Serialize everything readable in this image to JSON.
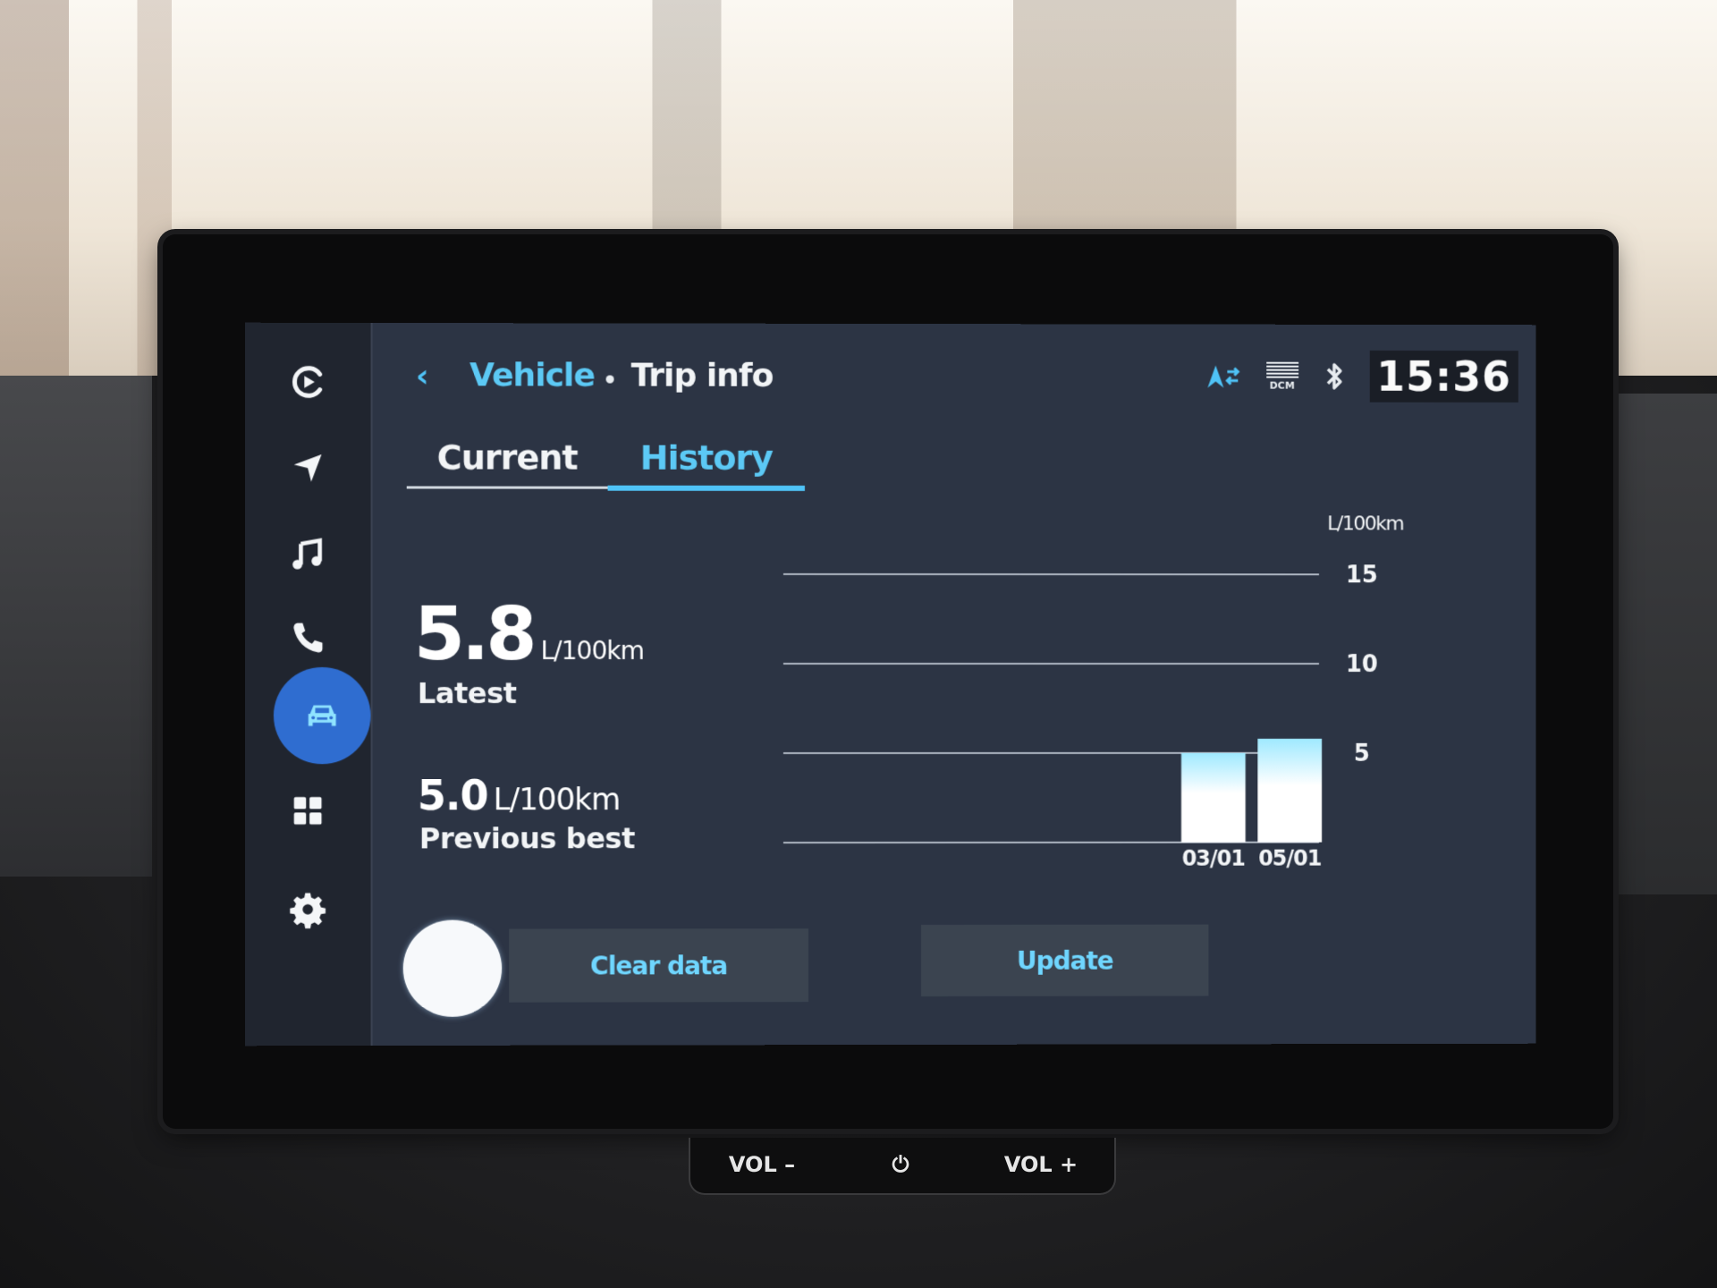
{
  "header": {
    "back_glyph": "‹",
    "breadcrumb_parent": "Vehicle",
    "page_title": "Trip info",
    "status": {
      "nav_icon": "navigation-sync-icon",
      "dcm_label": "DCM",
      "bluetooth_icon": "bluetooth-icon",
      "clock": "15:36"
    }
  },
  "sidebar": {
    "items": [
      {
        "name": "media-player",
        "icon": "play-circle-icon",
        "active": false
      },
      {
        "name": "navigation",
        "icon": "navigation-arrow-icon",
        "active": false
      },
      {
        "name": "music",
        "icon": "music-note-icon",
        "active": false
      },
      {
        "name": "phone",
        "icon": "phone-icon",
        "active": false
      },
      {
        "name": "vehicle",
        "icon": "car-icon",
        "active": true
      },
      {
        "name": "apps",
        "icon": "grid-icon",
        "active": false
      },
      {
        "name": "settings",
        "icon": "gear-icon",
        "active": false
      }
    ]
  },
  "tabs": [
    {
      "label": "Current",
      "active": false
    },
    {
      "label": "History",
      "active": true
    }
  ],
  "metrics": {
    "latest_value": "5.8",
    "latest_unit": "L/100km",
    "latest_label": "Latest",
    "best_value": "5.0",
    "best_unit": "L/100km",
    "best_label": "Previous best"
  },
  "buttons": {
    "clear_data": "Clear data",
    "update": "Update"
  },
  "hardware": {
    "vol_minus": "VOL –",
    "power": "⏻",
    "vol_plus": "VOL +"
  },
  "colors": {
    "accent": "#4fc3f7",
    "active_nav": "#2f6dd0",
    "screen_bg": "#2c3444",
    "bar_top": "#9fe9ff",
    "bar_bottom": "#ffffff"
  },
  "chart_data": {
    "type": "bar",
    "title": "",
    "xlabel": "",
    "ylabel": "L/100km",
    "categories": [
      "03/01",
      "05/01"
    ],
    "values": [
      5.0,
      5.8
    ],
    "ylim": [
      0,
      15
    ],
    "yticks": [
      5,
      10,
      15
    ],
    "grid": true,
    "axis_position": "right",
    "legend": "none",
    "slots": 7,
    "slot_indices": [
      5,
      6
    ]
  }
}
